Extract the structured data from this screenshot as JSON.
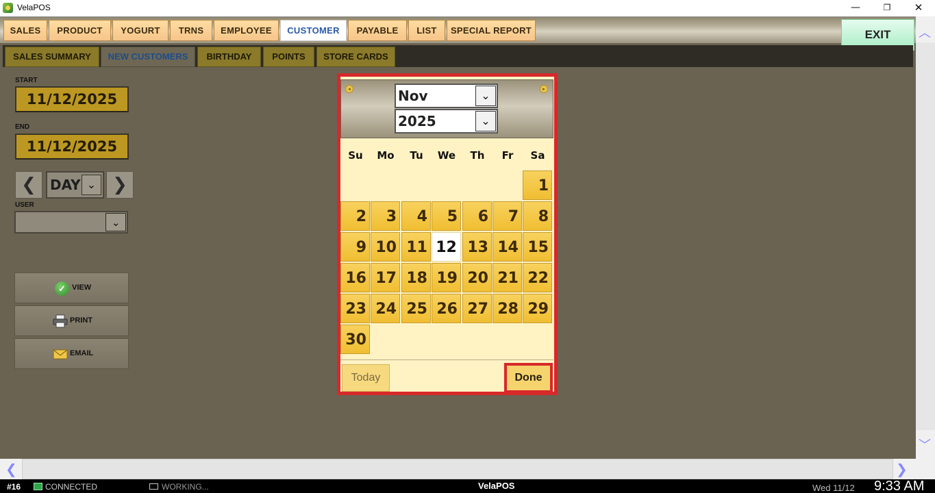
{
  "window": {
    "title": "VelaPOS",
    "controls": {
      "minimize": "—",
      "maximize": "❐",
      "close": "✕"
    }
  },
  "top_tabs": [
    {
      "label": "SALES"
    },
    {
      "label": "PRODUCT"
    },
    {
      "label": "YOGURT"
    },
    {
      "label": "TRNS"
    },
    {
      "label": "EMPLOYEE"
    },
    {
      "label": "CUSTOMER",
      "active": true
    },
    {
      "label": "PAYABLE"
    },
    {
      "label": "LIST"
    },
    {
      "label": "SPECIAL REPORT"
    }
  ],
  "exit_label": "EXIT",
  "sub_tabs": [
    {
      "label": "SALES SUMMARY"
    },
    {
      "label": "NEW CUSTOMERS",
      "active": true
    },
    {
      "label": "BIRTHDAY"
    },
    {
      "label": "POINTS"
    },
    {
      "label": "STORE CARDS"
    }
  ],
  "filters": {
    "start_label": "START",
    "start_value": "11/12/2025",
    "end_label": "END",
    "end_value": "11/12/2025",
    "prev_icon": "❮",
    "next_icon": "❯",
    "period_value": "DAY",
    "period_arrow": "⌄",
    "user_label": "USER",
    "user_value": "",
    "user_arrow": "⌄"
  },
  "actions": {
    "view": "VIEW",
    "print": "PRINT",
    "email": "EMAIL",
    "view_icon": "✓"
  },
  "calendar": {
    "month": "Nov",
    "year": "2025",
    "select_arrow": "⌄",
    "prev_icon": "◂",
    "next_icon": "▸",
    "weekdays": [
      "Su",
      "Mo",
      "Tu",
      "We",
      "Th",
      "Fr",
      "Sa"
    ],
    "first_weekday": 6,
    "days_in_month": 30,
    "selected_day": 12,
    "today_label": "Today",
    "done_label": "Done"
  },
  "scroll": {
    "up": "︿",
    "down": "﹀",
    "left": "❮",
    "right": "❯"
  },
  "statusbar": {
    "station": "#16",
    "connection": "CONNECTED",
    "working": "WORKING...",
    "app": "VelaPOS",
    "date": "Wed 11/12",
    "time": "9:33 AM"
  },
  "colors": {
    "background": "#6a6352",
    "calendar_border": "#d7282a",
    "day_fill": "#f0be32",
    "active_tab_text": "#2a5aa8"
  }
}
